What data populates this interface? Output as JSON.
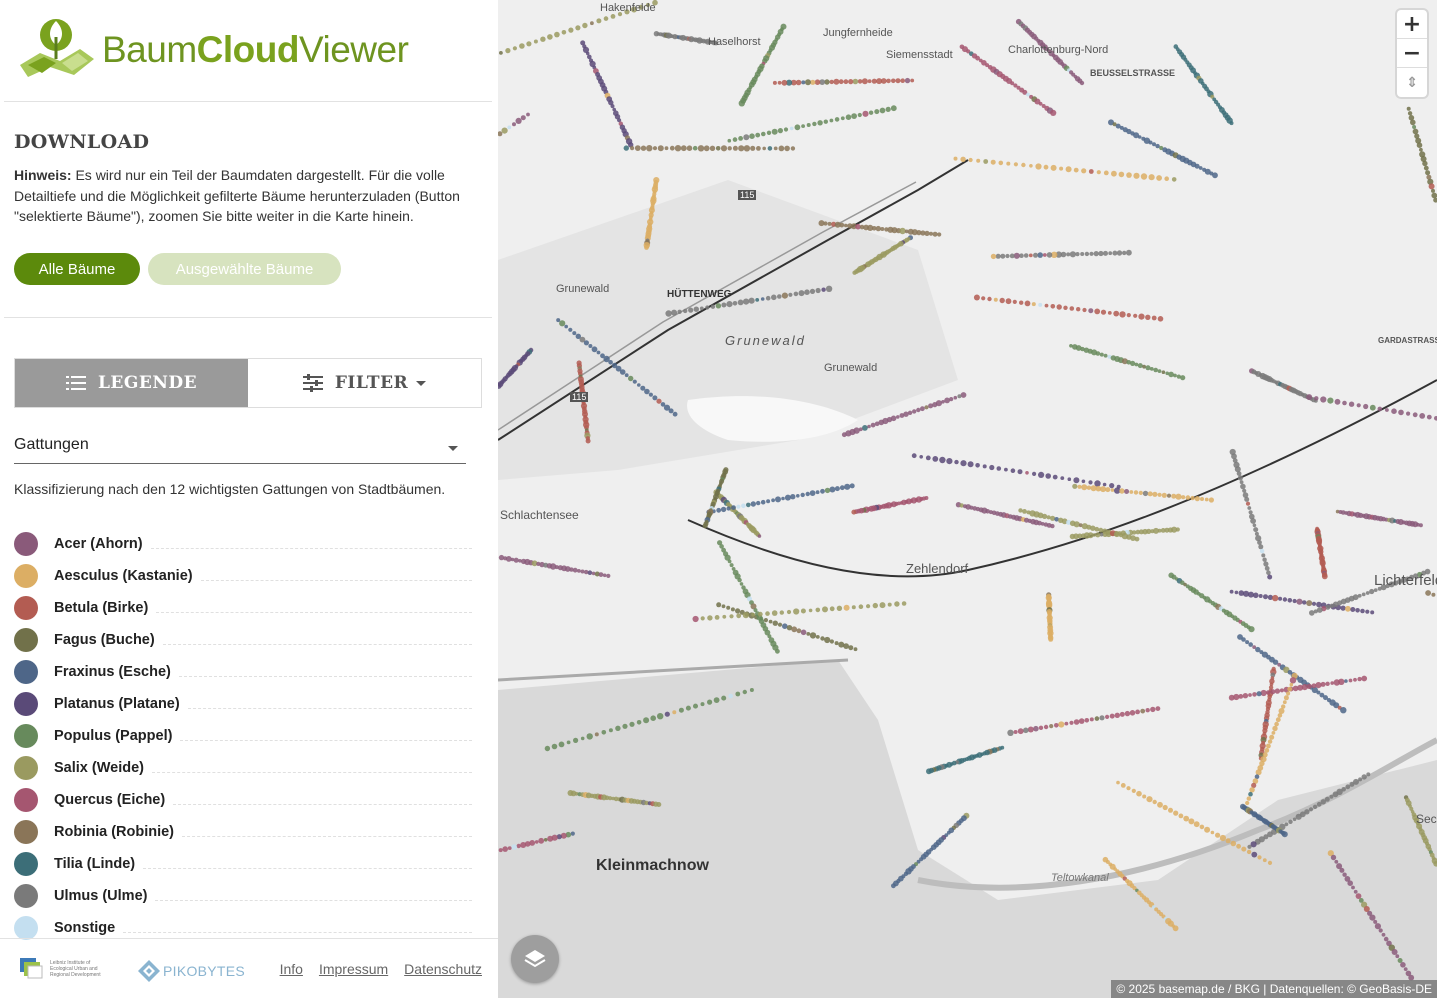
{
  "app": {
    "logo_text_part1": "Baum",
    "logo_text_part2": "Cloud",
    "logo_text_part3": "Viewer"
  },
  "download": {
    "title": "DOWNLOAD",
    "hint_label": "Hinweis:",
    "hint_text": " Es wird nur ein Teil der Baumdaten dargestellt. Für die volle Detailtiefe und die Möglichkeit gefilterte Bäume herunterzuladen (Button \"selektierte Bäume\"), zoomen Sie bitte weiter in die Karte hinein.",
    "btn_all": "Alle Bäume",
    "btn_selected": "Ausgewählte Bäume"
  },
  "tabs": {
    "legend": "LEGENDE",
    "filter": "FILTER"
  },
  "classification": {
    "selected": "Gattungen",
    "description": "Klassifizierung nach den 12 wichtigsten Gattungen von Stadtbäumen."
  },
  "legend": [
    {
      "label": "Acer (Ahorn)",
      "color": "#8a5a7a"
    },
    {
      "label": "Aesculus (Kastanie)",
      "color": "#dcae64"
    },
    {
      "label": "Betula (Birke)",
      "color": "#b35c52"
    },
    {
      "label": "Fagus (Buche)",
      "color": "#71714a"
    },
    {
      "label": "Fraxinus (Esche)",
      "color": "#4e6688"
    },
    {
      "label": "Platanus (Platane)",
      "color": "#5a4a78"
    },
    {
      "label": "Populus (Pappel)",
      "color": "#678a5c"
    },
    {
      "label": "Salix (Weide)",
      "color": "#9a9a60"
    },
    {
      "label": "Quercus (Eiche)",
      "color": "#a55670"
    },
    {
      "label": "Robinia (Robinie)",
      "color": "#8a7558"
    },
    {
      "label": "Tilia (Linde)",
      "color": "#3c6e78"
    },
    {
      "label": "Ulmus (Ulme)",
      "color": "#7a7a7a"
    },
    {
      "label": "Sonstige",
      "color": "#c4dff0"
    }
  ],
  "footer": {
    "ioer_text": "Leibniz Institute of Ecological Urban and Regional Development",
    "pikobytes": "PIKOBYTES",
    "links": [
      "Info",
      "Impressum",
      "Datenschutz"
    ]
  },
  "map": {
    "labels": [
      "Hakenfelde",
      "Haselhorst",
      "Jungfernheide",
      "Siemensstadt",
      "Charlottenburg-Nord",
      "BEUSSELSTRASSE",
      "Grunewald",
      "HÜTTENWEG",
      "Grunewald",
      "Grunewald",
      "Kleinmachnow",
      "Teltowkanal",
      "Lichterfelde",
      "Zehlendorf",
      "Schlachtensee",
      "115",
      "115",
      "GARDASTRASSE",
      "Sec"
    ],
    "controls": {
      "zoom_in": "+",
      "zoom_out": "−",
      "compass": "⇕"
    },
    "attribution": "© 2025 basemap.de / BKG | Datenquellen: © GeoBasis-DE"
  }
}
